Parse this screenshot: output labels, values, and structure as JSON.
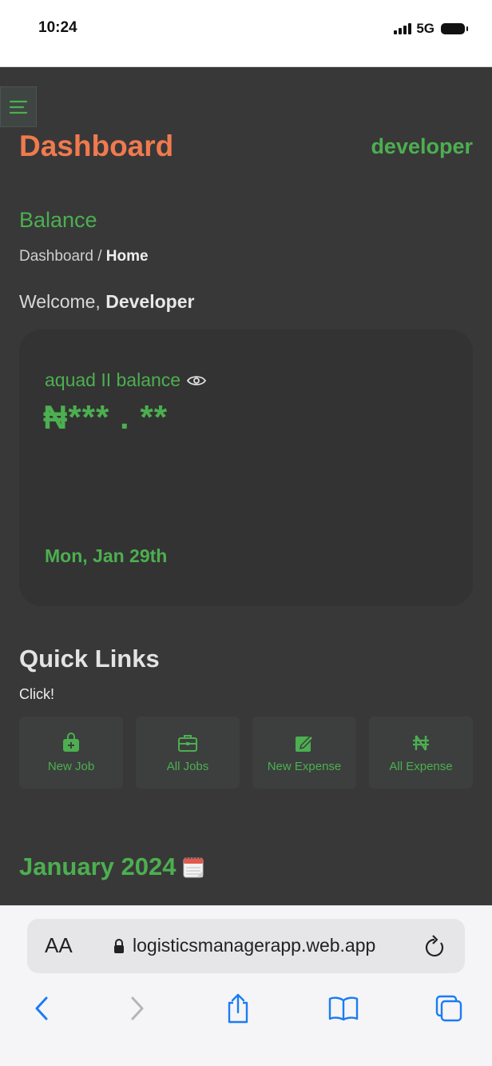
{
  "status_bar": {
    "time": "10:24",
    "network": "5G"
  },
  "header": {
    "title": "Dashboard",
    "username": "developer",
    "menu_icon": "hamburger-icon"
  },
  "page": {
    "section": "Balance",
    "breadcrumb": {
      "parent": "Dashboard",
      "separator": " / ",
      "current": "Home"
    },
    "welcome_prefix": "Welcome, ",
    "welcome_name": "Developer"
  },
  "balance_card": {
    "label": "aquad II balance",
    "amount": "₦*** . **",
    "date": "Mon, Jan 29th",
    "visibility_icon": "eye-icon"
  },
  "quick_links": {
    "title": "Quick Links",
    "subtitle": "Click!",
    "items": [
      {
        "label": "New Job",
        "icon": "bag-plus-icon"
      },
      {
        "label": "All Jobs",
        "icon": "briefcase-icon"
      },
      {
        "label": "New Expense",
        "icon": "edit-icon"
      },
      {
        "label": "All Expense",
        "icon": "naira-icon"
      }
    ]
  },
  "calendar": {
    "month": "January 2024",
    "icon": "calendar-icon"
  },
  "browser": {
    "text_size_label": "AA",
    "url": "logisticsmanagerapp.web.app",
    "icons": [
      "lock-icon",
      "reload-icon",
      "back-icon",
      "forward-icon",
      "share-icon",
      "bookmarks-icon",
      "tabs-icon"
    ]
  },
  "colors": {
    "accent_green": "#4caf50",
    "title_orange": "#f07a4e",
    "background": "#383838"
  }
}
